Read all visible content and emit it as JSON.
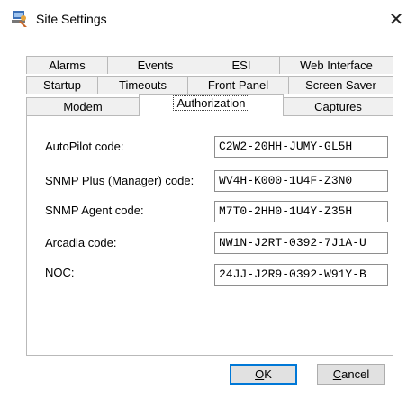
{
  "window": {
    "title": "Site Settings",
    "close_glyph": "✕"
  },
  "tabs": {
    "row1": [
      "Alarms",
      "Events",
      "ESI",
      "Web Interface"
    ],
    "row2": [
      "Startup",
      "Timeouts",
      "Front Panel",
      "Screen Saver"
    ],
    "row3": [
      "Modem",
      "Authorization",
      "Captures"
    ],
    "active": "Authorization"
  },
  "fields": [
    {
      "label": "AutoPilot code:",
      "value": "C2W2-20HH-JUMY-GL5H"
    },
    {
      "label": "SNMP Plus (Manager) code:",
      "value": "WV4H-K000-1U4F-Z3N0"
    },
    {
      "label": "SNMP Agent code:",
      "value": "M7T0-2HH0-1U4Y-Z35H"
    },
    {
      "label": "Arcadia code:",
      "value": "NW1N-J2RT-0392-7J1A-U"
    },
    {
      "label": "NOC:",
      "value": "24JJ-J2R9-0392-W91Y-B"
    }
  ],
  "buttons": {
    "ok_mnemonic": "O",
    "ok_rest": "K",
    "cancel_mnemonic": "C",
    "cancel_rest": "ancel"
  },
  "icons": {
    "app": "settings-app-icon",
    "close": "close-icon"
  }
}
